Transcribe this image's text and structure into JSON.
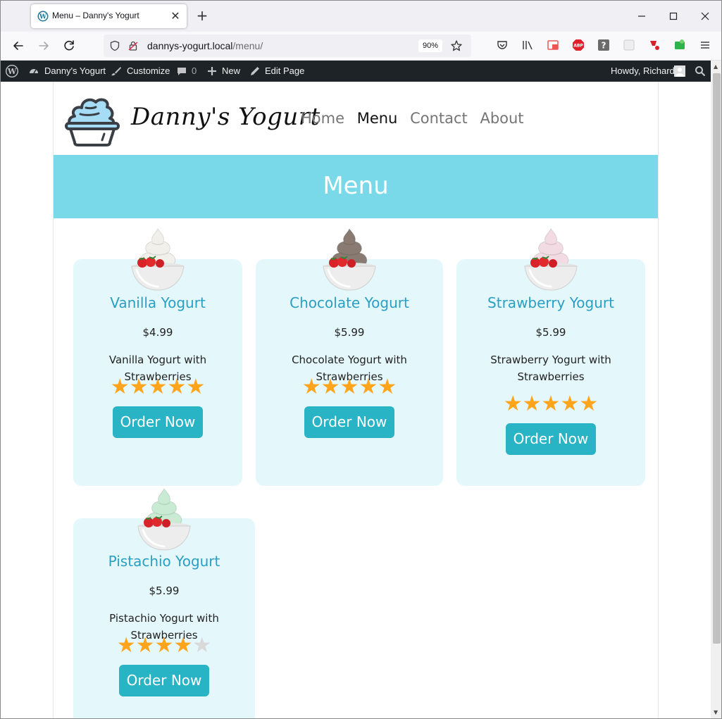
{
  "browser": {
    "tab_title": "Menu – Danny's Yogurt",
    "url_host": "dannys-yogurt.local",
    "url_path": "/menu/",
    "zoom": "90%"
  },
  "admin_bar": {
    "site_name": "Danny's Yogurt",
    "customize": "Customize",
    "comments_count": "0",
    "new": "New",
    "edit_page": "Edit Page",
    "howdy": "Howdy, Richard"
  },
  "site": {
    "title": "Danny's Yogurt",
    "nav": [
      "Home",
      "Menu",
      "Contact",
      "About"
    ],
    "active_nav": "Menu"
  },
  "hero": {
    "title": "Menu"
  },
  "products": [
    {
      "name": "Vanilla Yogurt",
      "price": "$4.99",
      "description": "Vanilla Yogurt with Strawberries",
      "rating": 5,
      "button": "Order Now",
      "swirl_color": "#f2f0ea"
    },
    {
      "name": "Chocolate Yogurt",
      "price": "$5.99",
      "description": "Chocolate Yogurt with Strawberries",
      "rating": 5,
      "button": "Order Now",
      "swirl_color": "#8a7b72"
    },
    {
      "name": "Strawberry Yogurt",
      "price": "$5.99",
      "description": "Strawberry Yogurt with Strawberries",
      "rating": 5,
      "button": "Order Now",
      "swirl_color": "#f2dbe3"
    },
    {
      "name": "Pistachio Yogurt",
      "price": "$5.99",
      "description": "Pistachio Yogurt with Strawberries",
      "rating": 4,
      "button": "Order Now",
      "swirl_color": "#c9ebd4"
    }
  ],
  "colors": {
    "hero_bg": "#7ad9e8",
    "card_bg": "#e4f7fb",
    "title_color": "#2a9fc4",
    "button_bg": "#29b4c6",
    "star_on": "#ffa41b",
    "star_off": "#d9d9d9",
    "admin_bar_bg": "#1d2327"
  },
  "icons": [
    "wordpress-favicon",
    "close-tab-icon",
    "new-tab-icon",
    "minimize-icon",
    "maximize-icon",
    "close-window-icon",
    "back-icon",
    "forward-icon",
    "reload-icon",
    "shield-icon",
    "lock-icon",
    "star-bookmark-icon",
    "pocket-icon",
    "library-icon",
    "extension-icon",
    "adblock-icon",
    "help-icon",
    "menu-icon",
    "wordpress-icon",
    "dashboard-icon",
    "brush-icon",
    "comment-icon",
    "plus-icon",
    "pencil-icon",
    "avatar-icon",
    "search-icon"
  ]
}
